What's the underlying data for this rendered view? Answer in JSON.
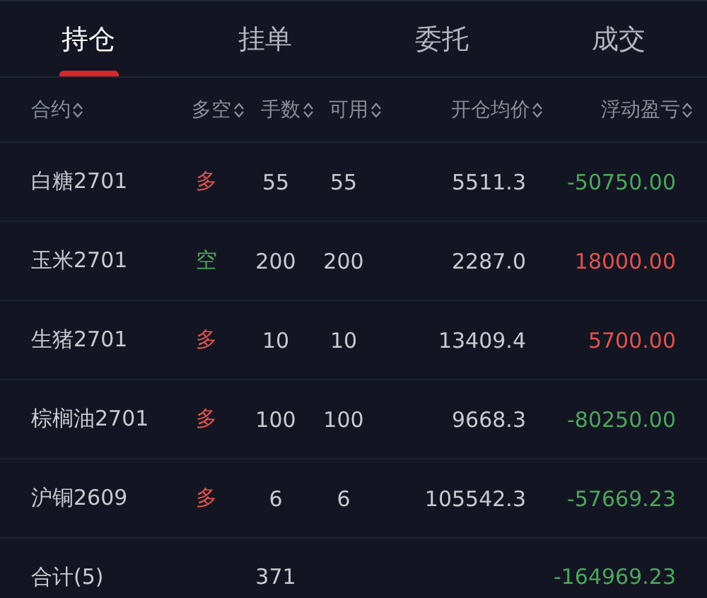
{
  "tabs": [
    {
      "label": "持仓",
      "selected": true
    },
    {
      "label": "挂单",
      "selected": false
    },
    {
      "label": "委托",
      "selected": false
    },
    {
      "label": "成交",
      "selected": false
    }
  ],
  "columns": [
    "合约",
    "多空",
    "手数",
    "可用",
    "开仓均价",
    "浮动盈亏"
  ],
  "rows": [
    {
      "contract": "白糖2701",
      "side": "多",
      "long": true,
      "lots": "55",
      "available": "55",
      "avg_price": "5511.3",
      "pnl": "-50750.00",
      "profit": false
    },
    {
      "contract": "玉米2701",
      "side": "空",
      "long": false,
      "lots": "200",
      "available": "200",
      "avg_price": "2287.0",
      "pnl": "18000.00",
      "profit": true
    },
    {
      "contract": "生猪2701",
      "side": "多",
      "long": true,
      "lots": "10",
      "available": "10",
      "avg_price": "13409.4",
      "pnl": "5700.00",
      "profit": true
    },
    {
      "contract": "棕榈油2701",
      "side": "多",
      "long": true,
      "lots": "100",
      "available": "100",
      "avg_price": "9668.3",
      "pnl": "-80250.00",
      "profit": false
    },
    {
      "contract": "沪铜2609",
      "side": "多",
      "long": true,
      "lots": "6",
      "available": "6",
      "avg_price": "105542.3",
      "pnl": "-57669.23",
      "profit": false
    }
  ],
  "total": {
    "label": "合计(5)",
    "lots": "371",
    "pnl": "-164969.23",
    "profit": false
  }
}
